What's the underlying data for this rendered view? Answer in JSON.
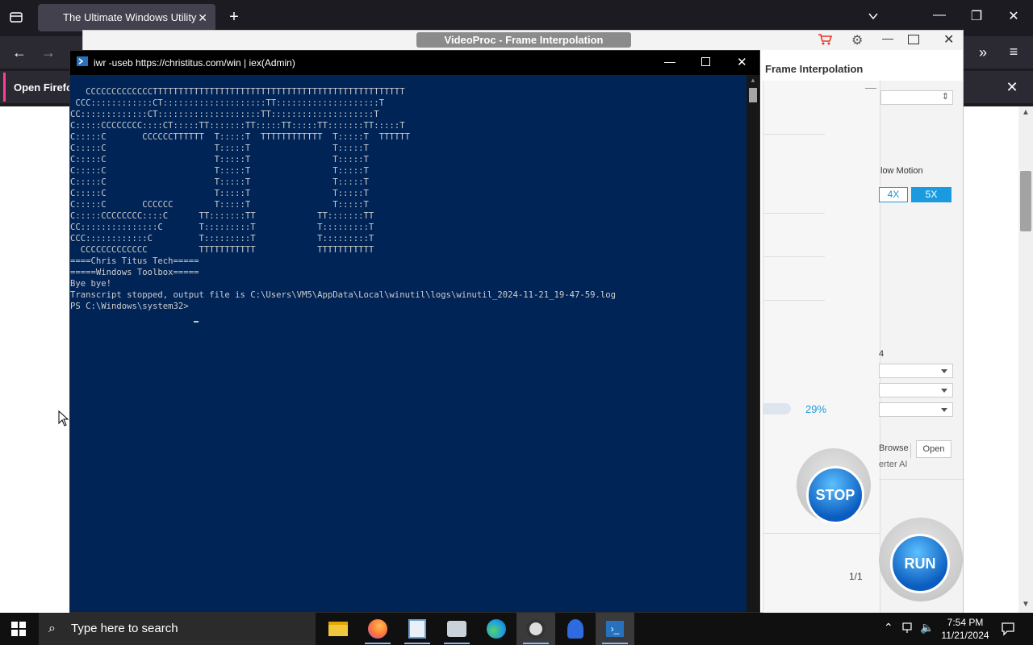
{
  "firefox": {
    "tab_title": "The Ultimate Windows Utility",
    "new_tab_symbol": "+",
    "notification_text": "Open Firefo"
  },
  "videoproc": {
    "window_title": "VideoProc - Frame Interpolation",
    "panel_title": "Frame Interpolation",
    "slow_motion_label": "low Motion",
    "speed_4x": "4X",
    "speed_5x": "5X",
    "partial_label": "4",
    "progress": "29%",
    "progress_value": 0.29,
    "browse_label": "Browse",
    "open_label": "Open",
    "ai_label": "erter AI",
    "stop_label": "STOP",
    "page_counter": "1/1",
    "run_label": "RUN",
    "accent_color": "#1a9be0"
  },
  "powershell": {
    "title": "iwr -useb https://christitus.com/win | iex(Admin)",
    "lines": [
      "   CCCCCCCCCCCCCTTTTTTTTTTTTTTTTTTTTTTTTTTTTTTTTTTTTTTTTTTTTTTTTT",
      " CCC::::::::::::CT::::::::::::::::::::TT::::::::::::::::::::T",
      "CC:::::::::::::CT::::::::::::::::::::TT::::::::::::::::::::T",
      "C:::::CCCCCCCC::::CT:::::TT:::::::TT:::::TT:::::TT:::::::TT:::::T",
      "C:::::C       CCCCCCTTTTTT  T:::::T  TTTTTTTTTTTT  T:::::T  TTTTTT",
      "C:::::C                     T:::::T                T:::::T",
      "C:::::C                     T:::::T                T:::::T",
      "C:::::C                     T:::::T                T:::::T",
      "C:::::C                     T:::::T                T:::::T",
      "C:::::C                     T:::::T                T:::::T",
      "C:::::C       CCCCCC        T:::::T                T:::::T",
      "C:::::CCCCCCCC::::C      TT:::::::TT            TT:::::::TT",
      "CC:::::::::::::::C       T:::::::::T            T:::::::::T",
      "CCC::::::::::::C         T:::::::::T            T:::::::::T",
      "  CCCCCCCCCCCCC          TTTTTTTTTTT            TTTTTTTTTTT",
      "",
      "====Chris Titus Tech=====",
      "=====Windows Toolbox=====",
      "Bye bye!",
      "Transcript stopped, output file is C:\\Users\\VM5\\AppData\\Local\\winutil\\logs\\winutil_2024-11-21_19-47-59.log",
      "PS C:\\Windows\\system32> "
    ],
    "bg_color": "#012456"
  },
  "taskbar": {
    "search_placeholder": "Type here to search",
    "time": "7:54 PM",
    "date": "11/21/2024"
  }
}
